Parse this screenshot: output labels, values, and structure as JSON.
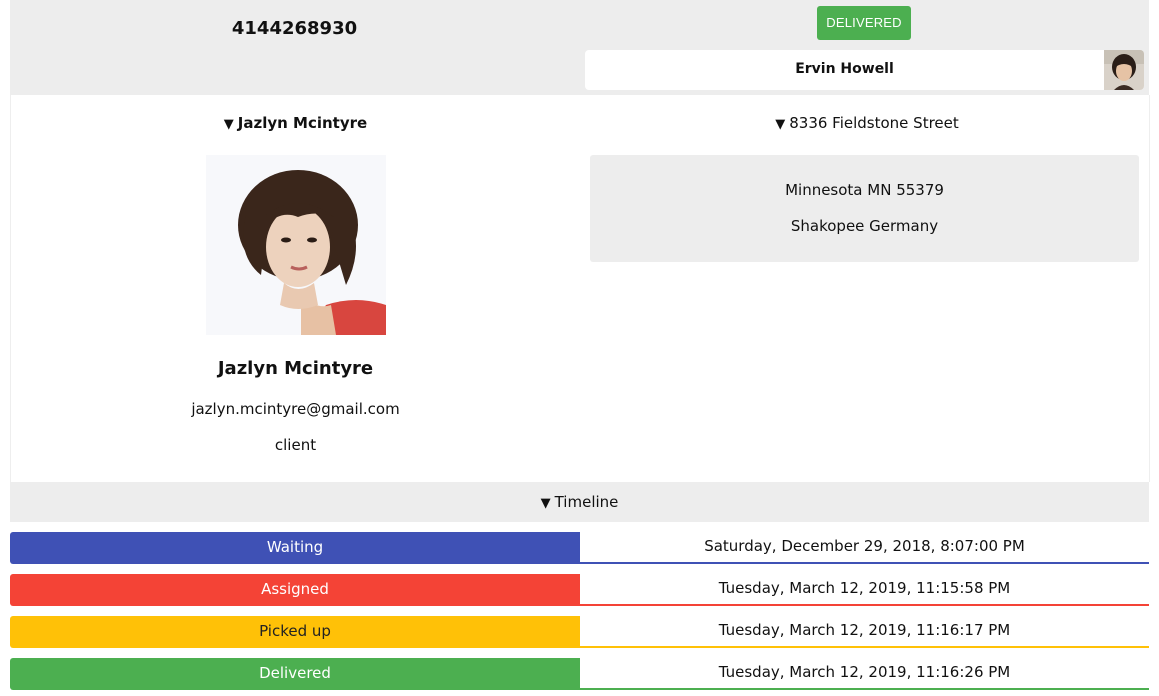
{
  "order": {
    "phone": "4144268930",
    "status": "DELIVERED",
    "status_color": "#4caf50"
  },
  "driver": {
    "name": "Ervin Howell",
    "avatar_icon": "driver-avatar-photo"
  },
  "client": {
    "summary": "Jazlyn Mcintyre",
    "name": "Jazlyn Mcintyre",
    "email": "jazlyn.mcintyre@gmail.com",
    "role": "client",
    "photo_icon": "client-photo"
  },
  "address": {
    "summary": "8336 Fieldstone Street",
    "line1": "Minnesota MN 55379",
    "line2": "Shakopee Germany"
  },
  "timeline": {
    "title": "Timeline",
    "events": [
      {
        "label": "Waiting",
        "date": "Saturday, December 29, 2018, 8:07:00 PM",
        "color": "#3f51b5",
        "text_color": "#ffffff"
      },
      {
        "label": "Assigned",
        "date": "Tuesday, March 12, 2019, 11:15:58 PM",
        "color": "#f44336",
        "text_color": "#ffffff"
      },
      {
        "label": "Picked up",
        "date": "Tuesday, March 12, 2019, 11:16:17 PM",
        "color": "#ffc107",
        "text_color": "#222222"
      },
      {
        "label": "Delivered",
        "date": "Tuesday, March 12, 2019, 11:16:26 PM",
        "color": "#4caf50",
        "text_color": "#ffffff"
      }
    ]
  },
  "icons": {
    "disclosure": "▼"
  }
}
